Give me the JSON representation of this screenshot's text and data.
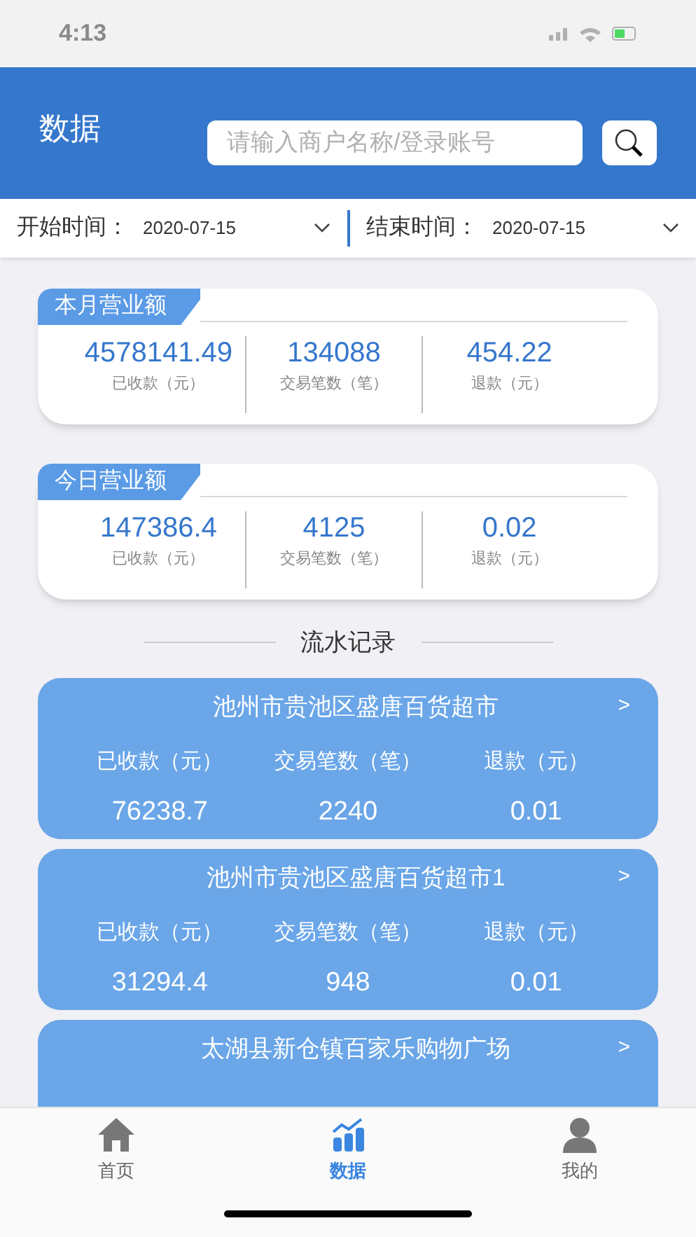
{
  "status_bar": {
    "time": "4:13"
  },
  "header": {
    "title": "数据",
    "search": {
      "placeholder": "请输入商户名称/登录账号"
    }
  },
  "date_filter": [
    {
      "label": "开始时间：",
      "value": "2020-07-15"
    },
    {
      "label": "结束时间：",
      "value": "2020-07-15"
    }
  ],
  "summaries": [
    {
      "title": "本月营业额",
      "stats": [
        {
          "value": "4578141.49",
          "label": "已收款（元）"
        },
        {
          "value": "134088",
          "label": "交易笔数（笔）"
        },
        {
          "value": "454.22",
          "label": "退款（元）"
        }
      ]
    },
    {
      "title": "今日营业额",
      "stats": [
        {
          "value": "147386.4",
          "label": "已收款（元）"
        },
        {
          "value": "4125",
          "label": "交易笔数（笔）"
        },
        {
          "value": "0.02",
          "label": "退款（元）"
        }
      ]
    }
  ],
  "records_heading": "流水记录",
  "records": [
    {
      "name": "池州市贵池区盛唐百货超市",
      "chevron": ">",
      "stats": [
        {
          "label": "已收款（元）",
          "value": "76238.7"
        },
        {
          "label": "交易笔数（笔）",
          "value": "2240"
        },
        {
          "label": "退款（元）",
          "value": "0.01"
        }
      ]
    },
    {
      "name": "池州市贵池区盛唐百货超市1",
      "chevron": ">",
      "stats": [
        {
          "label": "已收款（元）",
          "value": "31294.4"
        },
        {
          "label": "交易笔数（笔）",
          "value": "948"
        },
        {
          "label": "退款（元）",
          "value": "0.01"
        }
      ]
    },
    {
      "name": "太湖县新仓镇百家乐购物广场",
      "chevron": ">"
    }
  ],
  "tab_bar": [
    {
      "label": "首页",
      "kind": "home",
      "selected": false
    },
    {
      "label": "数据",
      "kind": "chart",
      "selected": true
    },
    {
      "label": "我的",
      "kind": "person",
      "selected": false
    }
  ]
}
